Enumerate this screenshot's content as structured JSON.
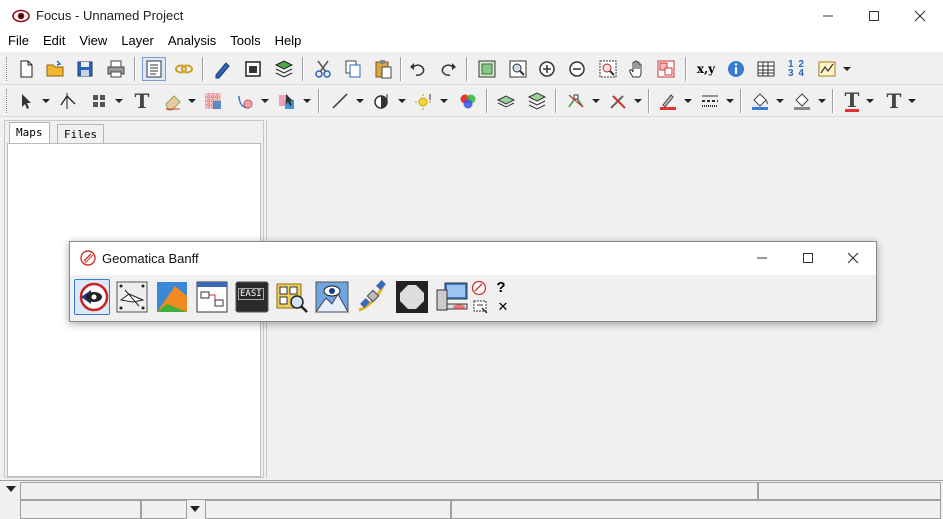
{
  "window": {
    "title": "Focus - Unnamed Project"
  },
  "menu": {
    "items": [
      "File",
      "Edit",
      "View",
      "Layer",
      "Analysis",
      "Tools",
      "Help"
    ]
  },
  "toolbar1": {
    "icons": [
      "new-file-icon",
      "open-folder-icon",
      "save-icon",
      "print-icon",
      "project-tree-icon",
      "link-icon",
      "edit-layer-icon",
      "view-frame-icon",
      "layers-icon",
      "cut-icon",
      "copy-icon",
      "paste-icon",
      "undo-icon",
      "redo-icon",
      "zoom-extent-icon",
      "zoom-window-icon",
      "zoom-in-icon",
      "zoom-out-icon",
      "zoom-select-icon",
      "pan-hand-icon",
      "overview-icon",
      "xy-coordinate-icon",
      "info-icon",
      "attribute-table-icon",
      "numbered-list-icon",
      "chart-icon"
    ],
    "coord_label": "x,y",
    "number_label": "1 2 3 4"
  },
  "toolbar2": {
    "icons": [
      "select-pointer-icon",
      "vertex-edit-icon",
      "grid-icon",
      "text-tool-icon",
      "paint-erase-icon",
      "raster-grid-icon",
      "fill-shape-icon",
      "arrow-select-icon",
      "line-tool-icon",
      "point-tool-icon",
      "sun-light-icon",
      "rgb-color-icon",
      "layer-stack-icon",
      "layer-stack-2-icon",
      "vector-edit-icon",
      "tools-icon",
      "pen-color-icon",
      "line-style-icon",
      "fill-color-icon",
      "outline-color-icon",
      "font-text-icon",
      "font-text-2-icon"
    ],
    "text_glyph": "T"
  },
  "left_panel": {
    "tabs": [
      "Maps",
      "Files"
    ],
    "active_tab": "Maps"
  },
  "banff": {
    "title": "Geomatica Banff",
    "apps": [
      "focus-icon",
      "orthoengine-icon",
      "modeler-icon",
      "flow-icon",
      "easi-icon",
      "chip-manager-icon",
      "image-viewer-icon",
      "satellite-icon",
      "fullscreen-icon",
      "license-server-icon"
    ],
    "easi_label": "EASI",
    "help_glyph": "?",
    "close_glyph": "✕"
  },
  "colors": {
    "accent": "#3a7bd5",
    "background": "#f0f0f0",
    "titlebar": "#ffffff"
  }
}
